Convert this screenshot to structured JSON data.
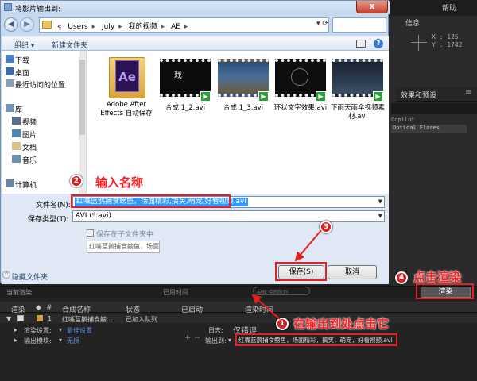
{
  "dialog": {
    "title": "将影片输出到:",
    "close_label": "x",
    "breadcrumbs": [
      "«",
      "Users",
      "July",
      "我的视频",
      "AE"
    ],
    "toolbar": {
      "organize": "组织 ▾",
      "new_folder": "新建文件夹"
    },
    "nav_items": [
      {
        "label": "下载",
        "icon": "download-icon"
      },
      {
        "label": "桌面",
        "icon": "desktop-icon"
      },
      {
        "label": "最近访问的位置",
        "icon": "recent-places-icon"
      },
      {
        "label": "库",
        "icon": "library-icon"
      },
      {
        "label": "视频",
        "icon": "video-library-icon"
      },
      {
        "label": "图片",
        "icon": "pictures-library-icon"
      },
      {
        "label": "文档",
        "icon": "documents-library-icon"
      },
      {
        "label": "音乐",
        "icon": "music-library-icon"
      },
      {
        "label": "计算机",
        "icon": "computer-icon"
      }
    ],
    "files": [
      {
        "name": "Adobe After Effects 自动保存",
        "type": "folder"
      },
      {
        "name": "合成 1_2.avi",
        "type": "video"
      },
      {
        "name": "合成 1_3.avi",
        "type": "video"
      },
      {
        "name": "环状文字效果.avi",
        "type": "video"
      },
      {
        "name": "下雨天雨伞视频素材.avi",
        "type": "video"
      }
    ],
    "filename_label": "文件名(N):",
    "filename_value": "红嘴蓝鹊捕食鳑鱼，场面精彩,搞笑,萌宠,好看视频.avi",
    "savetype_label": "保存类型(T):",
    "savetype_value": "AVI (*.avi)",
    "subfolder_label": "保存在子文件夹中",
    "subfolder_name": "红嘴蓝鹊捕食鳑鱼，场面",
    "hide_folders": "隐藏文件夹",
    "save_button": "保存(S)",
    "cancel_button": "取消"
  },
  "ae": {
    "help_menu": "帮助",
    "info_panel": "信息",
    "xy_readout": "X : 125\nY : 1742",
    "effects_panel": "效果和预设",
    "effects_close": "≡",
    "effects": [
      "Copilot",
      "Optical Flares"
    ],
    "current_render": "当前渲染",
    "elapsed": "已用时间",
    "ame_queue": "AME 中的队列",
    "render_button": "渲染",
    "columns": [
      "渲染",
      "#",
      "合成名称",
      "状态",
      "已启动",
      "渲染时间"
    ],
    "row": {
      "index": "1",
      "comp": "红嘴蓝鹊捕食鳑...",
      "status": "已加入队列"
    },
    "render_settings_label": "渲染设置:",
    "render_settings_value": "最佳设置",
    "log_label": "日志:",
    "log_value": "仅错误",
    "output_module_label": "输出模块:",
    "output_module_value": "无损",
    "output_to_label": "输出到:",
    "output_to_value": "红嘴蓝鹊捕食鳑鱼，场面精彩，搞笑，萌宠，好看视频.avi"
  },
  "annotations": [
    {
      "num": "1",
      "text": "在输出到处点击它"
    },
    {
      "num": "2",
      "text": "输入名称"
    },
    {
      "num": "3",
      "text": ""
    },
    {
      "num": "4",
      "text": "点击渲染"
    }
  ]
}
